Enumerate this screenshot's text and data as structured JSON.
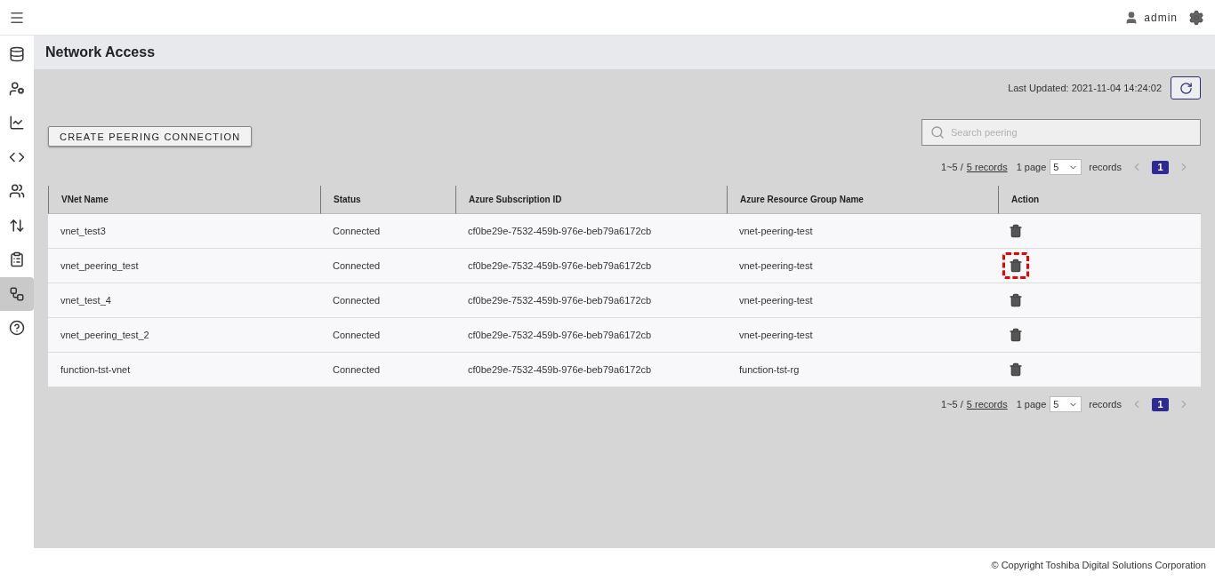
{
  "header": {
    "user": "admin"
  },
  "sidebar": {
    "items": [
      {
        "kind": "database",
        "selected": false
      },
      {
        "kind": "user-settings",
        "selected": false
      },
      {
        "kind": "chart",
        "selected": false
      },
      {
        "kind": "code",
        "selected": false
      },
      {
        "kind": "users",
        "selected": false
      },
      {
        "kind": "transfer",
        "selected": false
      },
      {
        "kind": "clipboard",
        "selected": false
      },
      {
        "kind": "network",
        "selected": true
      },
      {
        "kind": "help",
        "selected": false
      }
    ]
  },
  "page": {
    "title": "Network Access",
    "last_updated": "Last Updated: 2021-11-04 14:24:02"
  },
  "create_button": "CREATE PEERING CONNECTION",
  "search": {
    "placeholder": "Search peering"
  },
  "pagination_top": {
    "range": "1~5 / ",
    "records_link": "5 records",
    "page_label": "1 page",
    "page_size": "5",
    "records_label": "records",
    "current_page": "1"
  },
  "table": {
    "columns": [
      "VNet Name",
      "Status",
      "Azure Subscription ID",
      "Azure Resource Group Name",
      "Action"
    ],
    "rows": [
      {
        "cells": [
          "vnet_test3",
          "Connected",
          "cf0be29e-7532-459b-976e-beb79a6172cb",
          "vnet-peering-test"
        ],
        "highlighted": false
      },
      {
        "cells": [
          "vnet_peering_test",
          "Connected",
          "cf0be29e-7532-459b-976e-beb79a6172cb",
          "vnet-peering-test"
        ],
        "highlighted": true
      },
      {
        "cells": [
          "vnet_test_4",
          "Connected",
          "cf0be29e-7532-459b-976e-beb79a6172cb",
          "vnet-peering-test"
        ],
        "highlighted": false
      },
      {
        "cells": [
          "vnet_peering_test_2",
          "Connected",
          "cf0be29e-7532-459b-976e-beb79a6172cb",
          "vnet-peering-test"
        ],
        "highlighted": false
      },
      {
        "cells": [
          "function-tst-vnet",
          "Connected",
          "cf0be29e-7532-459b-976e-beb79a6172cb",
          "function-tst-rg"
        ],
        "highlighted": false
      }
    ]
  },
  "pagination_bottom": {
    "range": "1~5 / ",
    "records_link": "5 records",
    "page_label": "1 page",
    "page_size": "5",
    "records_label": "records",
    "current_page": "1"
  },
  "footer": "© Copyright Toshiba Digital Solutions Corporation"
}
